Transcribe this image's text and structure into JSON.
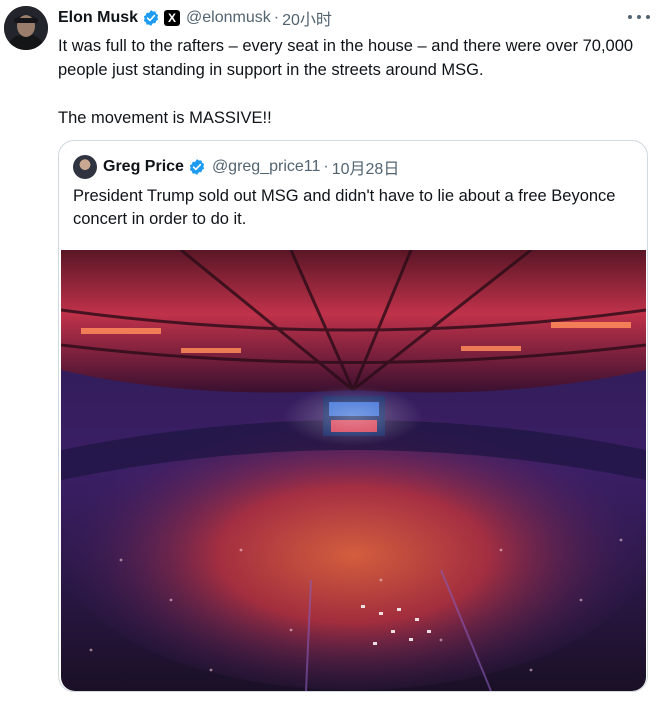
{
  "tweet": {
    "display_name": "Elon Musk",
    "handle": "@elonmusk",
    "separator": "·",
    "time": "20小时",
    "affiliation_badge": "X",
    "text_lines": [
      "It was full to the rafters – every seat in the house – and there were over 70,000 people just standing in support in the streets around MSG.",
      "The movement is MASSIVE!!"
    ],
    "verified_color": "#1d9bf0"
  },
  "quoted_tweet": {
    "display_name": "Greg Price",
    "handle": "@greg_price11",
    "separator": "·",
    "time": "10月28日",
    "text": "President Trump sold out MSG and didn't have to lie about a free Beyonce concert in order to do it.",
    "media": {
      "subject": "packed arena interior photo"
    }
  },
  "icons": {
    "more": "more-horizontal-icon",
    "verified": "verified-badge-icon"
  }
}
